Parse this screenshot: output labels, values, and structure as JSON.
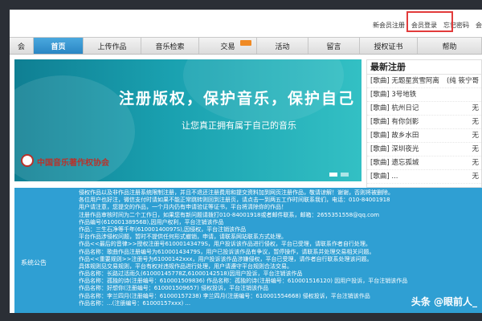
{
  "topbar": {
    "links": [
      "新会员注册",
      "会员登录",
      "忘记密码",
      "会"
    ]
  },
  "nav": {
    "items": [
      "会",
      "首页",
      "上传作品",
      "音乐检索",
      "交易",
      "活动",
      "留言",
      "授权证书",
      "帮助"
    ],
    "hot_color": "#f08a24"
  },
  "banner": {
    "title": "注册版权，保护音乐，保护自己",
    "subtitle": "让您真正拥有属于自己的音乐",
    "org": "中国音乐著作权协会"
  },
  "side": {
    "title": "最新注册",
    "rows": [
      {
        "title": "[歌曲] 无题星赏雪阿离",
        "author": "(纯 筱宁哥"
      },
      {
        "title": "[歌曲] 3号地铁",
        "author": ""
      },
      {
        "title": "[歌曲] 杭州日记",
        "author": "无"
      },
      {
        "title": "[歌曲] 有你剑影",
        "author": "无"
      },
      {
        "title": "[歌曲] 故乡水田",
        "author": "无"
      },
      {
        "title": "[歌曲] 深圳夜光",
        "author": "无"
      },
      {
        "title": "[歌曲] 遗忘孤城",
        "author": "无"
      },
      {
        "title": "[歌曲] ...",
        "author": "无"
      }
    ]
  },
  "notice": {
    "label": "系统公告",
    "lines": [
      "侵权作品以及非作品注册系统限制注册，并且不退还注册费用和提交资料加到网页注册作品，敬请谅解！谢谢，否则将被删除。",
      "各位用户也好注，微信支付时请如果不能正常跳转则回到注册页，请点击一到两五工作时间联系我们，电话：010-84001918",
      "用户请注意，您提交的作品，一个月内仍有申请验证等证书，平台将清除你的作品！",
      "注册作品审核时间为二个工作日，如果您有新问题请拨打010-84001918或者邮件联系，邮箱：2655351558@qq.com",
      "作品编号(61000138956B),因用户权利，平台注销该作品",
      "作品：三生石净等千年(61000140097S),因侵权，平台注销该作品",
      "平台作品涉侵权问题，暂时不提供任何形式撤销，申请，请联系网站联系方式处理。",
      "作品<<最后的音律>>授权注册号61000143479S，用户投诉该作品进行侵权，平台已受理，请联系作者自行处理。",
      "作品名称：歌曲作品注册编号为61000143479S，用户已投诉该作品有争议，暂停操作，请联系并处理交易相关问题。",
      "作品<<重要规则>>注册号为61000142xxx，用户投诉该作品涉嫌侵权，平台已受理，请作者自行联系处理该问题。",
      "具体规则见交易规则，平台有权对违规作品进行处理，用户请遵守平台规则合法交易。",
      "作品名称：长路过活雨久(61000145778Z,61000142518)因用户投诉，平台注销该作品",
      "作品名称：孤独的诗(注册编号：610001509836) 作品名称：孤独的诗(注册编号：610001516120) 因用户投诉，平台注销该作品",
      "作品名称：好想你(注册编号：610001509657) 侵权投诉，平台注销该作品",
      "作品名称：李兰四月(注册编号：61000157238) 李兰四月(注册编号：610001554668) 侵权投诉，平台注销该作品",
      "作品名称：...(注册编号：61000157xxx) ..."
    ]
  },
  "watermark": "头条 @眼前人_"
}
